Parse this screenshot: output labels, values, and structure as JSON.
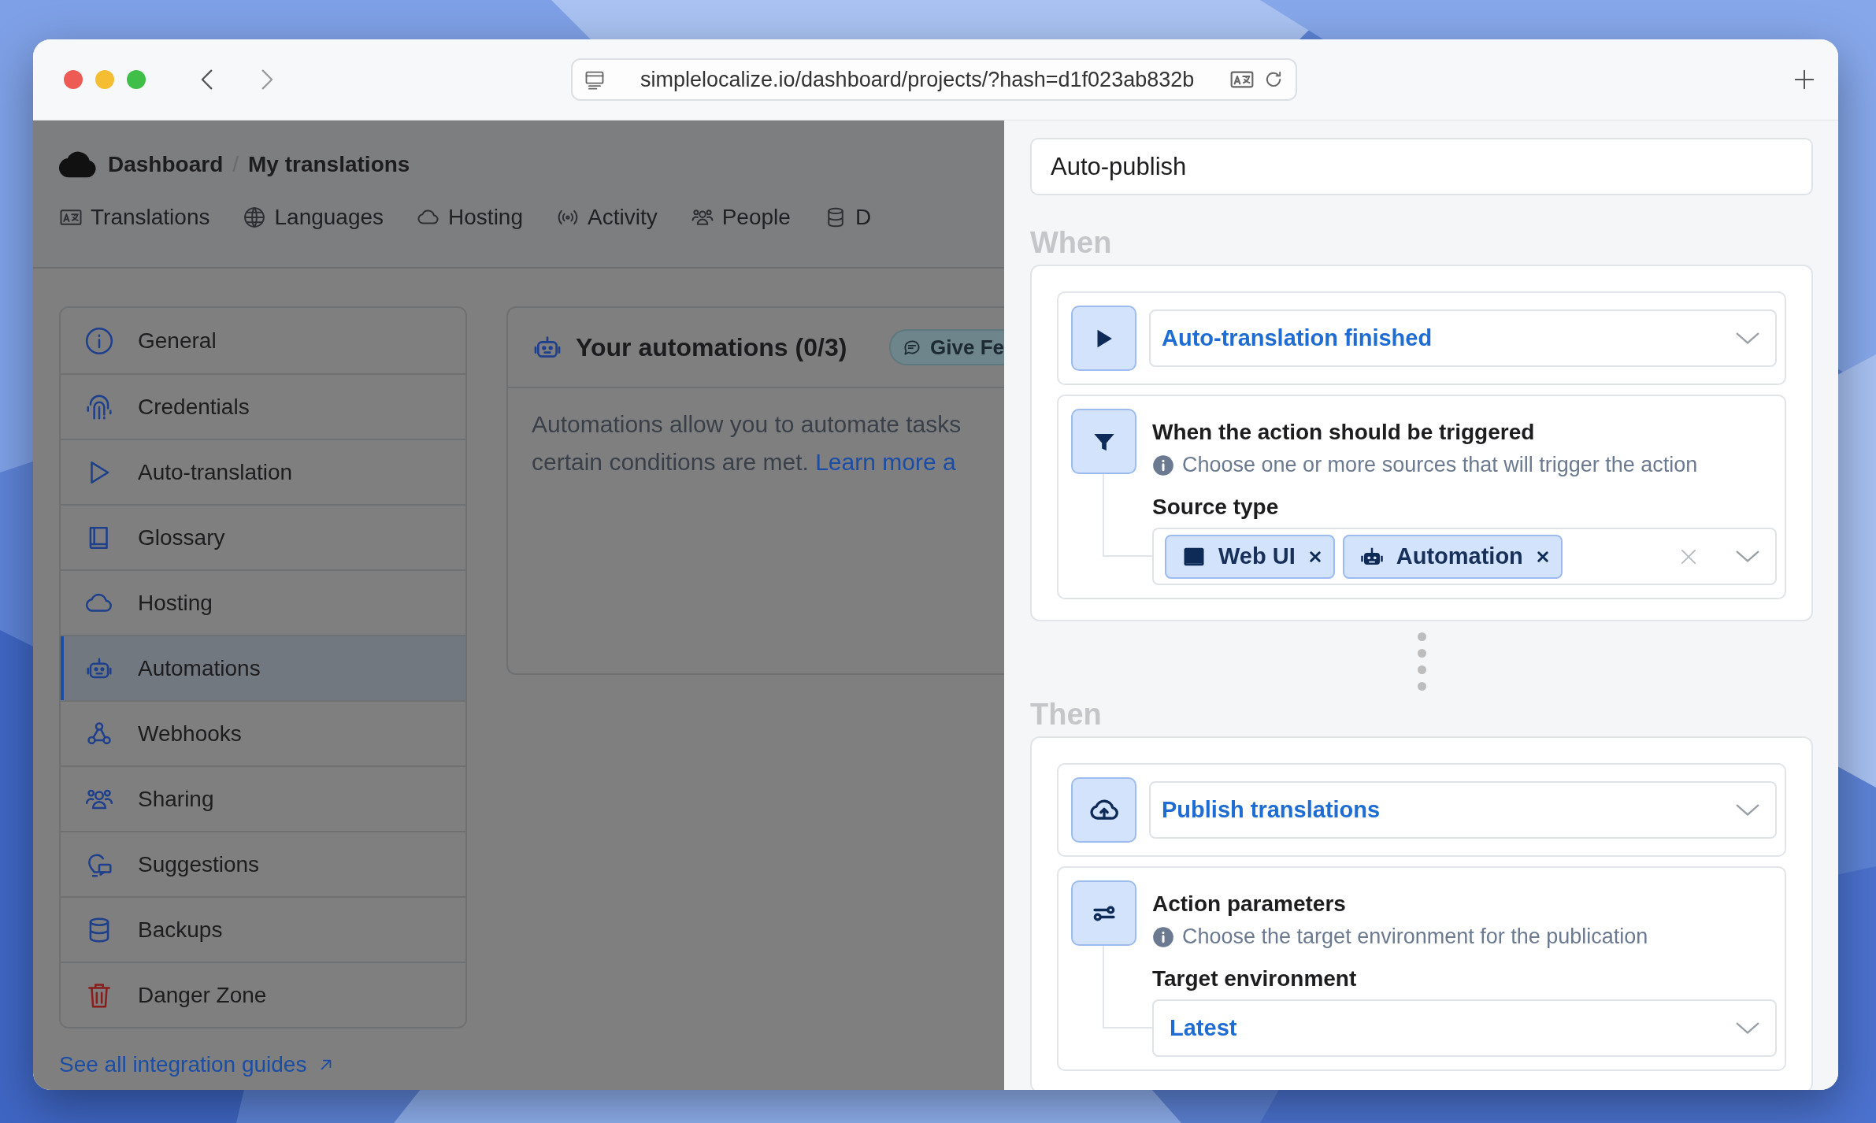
{
  "browser": {
    "url": "simplelocalize.io/dashboard/projects/?hash=d1f023ab832b"
  },
  "breadcrumb": [
    "Dashboard",
    "My translations"
  ],
  "breadcrumb_separator": "/",
  "tabs": [
    {
      "label": "Translations",
      "selected": false
    },
    {
      "label": "Languages",
      "selected": false
    },
    {
      "label": "Hosting",
      "selected": false
    },
    {
      "label": "Activity",
      "selected": false
    },
    {
      "label": "People",
      "selected": false
    },
    {
      "label": "D",
      "selected": false
    }
  ],
  "sidebar": {
    "items": [
      {
        "label": "General",
        "kind": "normal",
        "selected": false
      },
      {
        "label": "Credentials",
        "kind": "normal",
        "selected": false
      },
      {
        "label": "Auto-translation",
        "kind": "normal",
        "selected": false
      },
      {
        "label": "Glossary",
        "kind": "normal",
        "selected": false
      },
      {
        "label": "Hosting",
        "kind": "normal",
        "selected": false
      },
      {
        "label": "Automations",
        "kind": "normal",
        "selected": true
      },
      {
        "label": "Webhooks",
        "kind": "normal",
        "selected": false
      },
      {
        "label": "Sharing",
        "kind": "normal",
        "selected": false
      },
      {
        "label": "Suggestions",
        "kind": "normal",
        "selected": false
      },
      {
        "label": "Backups",
        "kind": "normal",
        "selected": false
      },
      {
        "label": "Danger Zone",
        "kind": "danger",
        "selected": false
      }
    ],
    "footer_link": "See all integration guides"
  },
  "automations_card": {
    "title": "Your automations (0/3)",
    "feedback_button": "Give Fe",
    "description_lines": [
      "Automations allow you to automate tasks",
      "certain conditions are met."
    ],
    "learn_more_link": "Learn more a"
  },
  "editor": {
    "name": {
      "value": "Auto-publish"
    },
    "when": {
      "heading": "When",
      "trigger": {
        "value": "Auto-translation finished"
      },
      "condition": {
        "title": "When the action should be triggered",
        "hint": "Choose one or more sources that will trigger the action",
        "field_label": "Source type",
        "tags": [
          "Web UI",
          "Automation"
        ]
      }
    },
    "then": {
      "heading": "Then",
      "action": {
        "value": "Publish translations"
      },
      "parameters": {
        "title": "Action parameters",
        "hint": "Choose the target environment for the publication",
        "field_label": "Target environment",
        "value": "Latest"
      }
    }
  }
}
